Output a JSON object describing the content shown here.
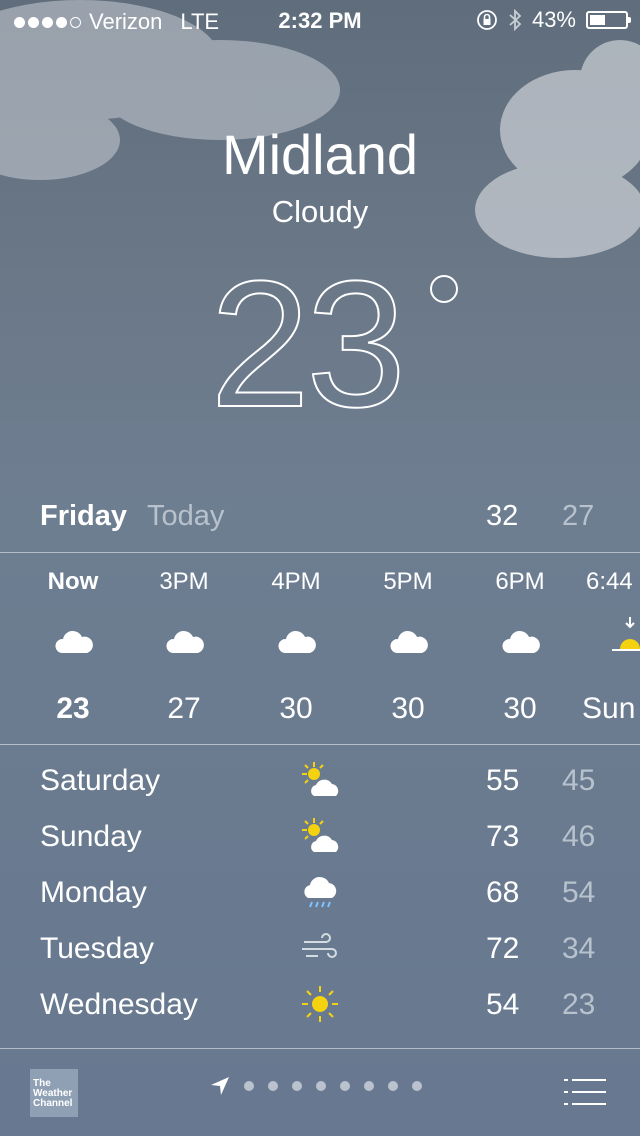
{
  "status_bar": {
    "signal_dots_filled": 4,
    "signal_dots_total": 5,
    "carrier": "Verizon",
    "network": "LTE",
    "time": "2:32 PM",
    "battery_percent": "43%",
    "battery_level": 0.43
  },
  "location": {
    "city": "Midland",
    "condition": "Cloudy",
    "temperature": "23"
  },
  "today": {
    "day": "Friday",
    "label": "Today",
    "high": "32",
    "low": "27"
  },
  "hourly": [
    {
      "time": "Now",
      "icon": "cloud-icon",
      "temp": "23"
    },
    {
      "time": "3PM",
      "icon": "cloud-icon",
      "temp": "27"
    },
    {
      "time": "4PM",
      "icon": "cloud-icon",
      "temp": "30"
    },
    {
      "time": "5PM",
      "icon": "cloud-icon",
      "temp": "30"
    },
    {
      "time": "6PM",
      "icon": "cloud-icon",
      "temp": "30"
    },
    {
      "time": "6:44",
      "icon": "sunset-icon",
      "temp": "Sun"
    }
  ],
  "daily": [
    {
      "day": "Saturday",
      "icon": "partly-cloudy-icon",
      "high": "55",
      "low": "45"
    },
    {
      "day": "Sunday",
      "icon": "partly-cloudy-icon",
      "high": "73",
      "low": "46"
    },
    {
      "day": "Monday",
      "icon": "rain-icon",
      "high": "68",
      "low": "54"
    },
    {
      "day": "Tuesday",
      "icon": "wind-icon",
      "high": "72",
      "low": "34"
    },
    {
      "day": "Wednesday",
      "icon": "sun-icon",
      "high": "54",
      "low": "23"
    }
  ],
  "footer": {
    "logo_text": [
      "The",
      "Weather",
      "Channel"
    ],
    "page_dots": 8
  },
  "colors": {
    "sun": "#f5d20f",
    "secondary_text": "#b8c2cd",
    "cloud": "#ffffff"
  }
}
